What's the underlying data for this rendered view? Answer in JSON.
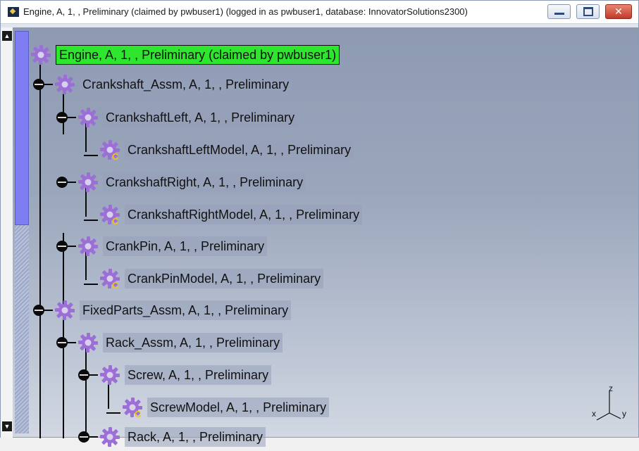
{
  "window": {
    "title": "Engine, A, 1, , Preliminary (claimed by pwbuser1) (logged in as pwbuser1, database: InnovatorSolutions2300)",
    "controls": {
      "minimize": "",
      "maximize": "",
      "close": "✕"
    }
  },
  "tree": {
    "nodes": [
      {
        "label": "Engine, A, 1, , Preliminary (claimed by pwbuser1)",
        "active": true,
        "icon": "gear-icon"
      },
      {
        "label": "Crankshaft_Assm, A, 1, , Preliminary",
        "icon": "gear-icon"
      },
      {
        "label": "CrankshaftLeft, A, 1, , Preliminary",
        "icon": "gear-icon"
      },
      {
        "label": "CrankshaftLeftModel, A, 1, , Preliminary",
        "icon": "gear-model-icon"
      },
      {
        "label": "CrankshaftRight, A, 1, , Preliminary",
        "icon": "gear-icon"
      },
      {
        "label": "CrankshaftRightModel, A, 1, , Preliminary",
        "icon": "gear-model-icon"
      },
      {
        "label": "CrankPin, A, 1, , Preliminary",
        "icon": "gear-icon"
      },
      {
        "label": "CrankPinModel, A, 1, , Preliminary",
        "icon": "gear-model-icon"
      },
      {
        "label": "FixedParts_Assm, A, 1, , Preliminary",
        "icon": "gear-icon"
      },
      {
        "label": "Rack_Assm, A, 1, , Preliminary",
        "icon": "gear-icon"
      },
      {
        "label": "Screw, A, 1, , Preliminary",
        "icon": "gear-icon"
      },
      {
        "label": "ScrewModel, A, 1, , Preliminary",
        "icon": "gear-model-icon"
      },
      {
        "label": "Rack, A, 1, , Preliminary",
        "icon": "gear-icon"
      }
    ]
  },
  "compass": {
    "z": "z",
    "x": "x",
    "y": "y"
  },
  "colors": {
    "active_highlight": "#2ee62e",
    "gear": "#9b6fd6",
    "model_badge": "#f2c21b",
    "scroll_thumb": "#7e7ef2"
  }
}
